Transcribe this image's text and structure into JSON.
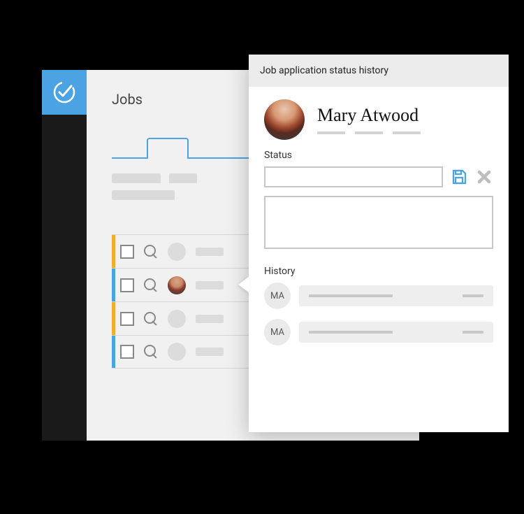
{
  "jobs_panel": {
    "title": "Jobs",
    "rows": [
      {
        "marker": "amber",
        "kind": "placeholder"
      },
      {
        "marker": "blue",
        "kind": "photo"
      },
      {
        "marker": "amber",
        "kind": "placeholder"
      },
      {
        "marker": "blue",
        "kind": "placeholder"
      }
    ]
  },
  "detail_panel": {
    "header": "Job application status history",
    "applicant": {
      "name": "Mary Atwood"
    },
    "status_label": "Status",
    "history_label": "History",
    "history": [
      {
        "initials": "MA"
      },
      {
        "initials": "MA"
      }
    ]
  },
  "icons": {
    "save": "save-icon",
    "cancel": "close-icon",
    "logo": "checkmark-logo-icon",
    "search": "magnifier-icon"
  },
  "colors": {
    "accent_blue": "#4ba3e3",
    "amber": "#f0ad2e"
  }
}
